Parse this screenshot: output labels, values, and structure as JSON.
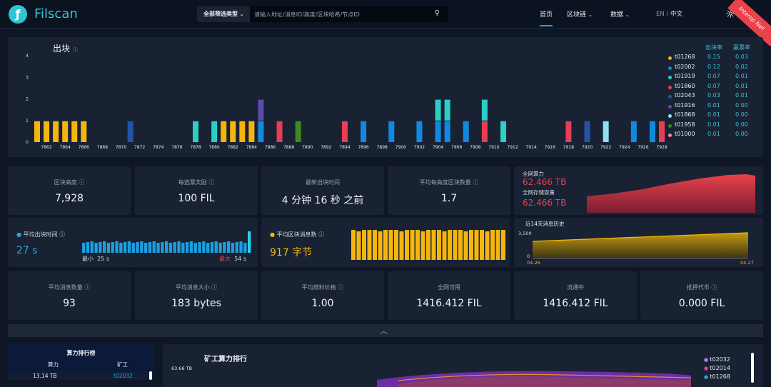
{
  "header": {
    "brand": "Filscan",
    "search_select": "全部筛选类型",
    "search_placeholder": "请输入地址/消息ID/高度/区块哈希/节点ID",
    "nav": [
      "首页",
      "区块链",
      "数据"
    ],
    "lang_en": "EN",
    "lang_sep": "/",
    "lang_zh": "中文",
    "ribbon": "Interop Net"
  },
  "blocks_chart": {
    "title": "出块",
    "col_rate1": "出块率",
    "col_rate2": "赢票率",
    "chart_data": {
      "type": "bar",
      "stacked": true,
      "ylim": [
        0,
        4
      ],
      "yticks": [
        "0",
        "1",
        "2",
        "3",
        "4"
      ],
      "x_labels": [
        "7862",
        "7864",
        "7866",
        "7868",
        "7870",
        "7872",
        "7874",
        "7876",
        "7878",
        "7880",
        "7882",
        "7884",
        "7886",
        "7888",
        "7890",
        "7892",
        "7894",
        "7896",
        "7898",
        "7900",
        "7902",
        "7904",
        "7906",
        "7908",
        "7910",
        "7912",
        "7914",
        "7916",
        "7918",
        "7920",
        "7922",
        "7924",
        "7926",
        "7928"
      ],
      "heights": [
        "7861",
        "7862",
        "7863",
        "7864",
        "7865",
        "7866",
        "7867",
        "7868",
        "7869",
        "7870",
        "7871",
        "7872",
        "7873",
        "7874",
        "7875",
        "7876",
        "7877",
        "7878",
        "7879",
        "7880",
        "7881",
        "7882",
        "7883",
        "7884",
        "7885",
        "7886",
        "7887",
        "7888",
        "7889",
        "7890",
        "7891",
        "7892",
        "7893",
        "7894",
        "7895",
        "7896",
        "7897",
        "7898",
        "7899",
        "7900",
        "7901",
        "7902",
        "7903",
        "7904",
        "7905",
        "7906",
        "7907",
        "7908",
        "7909",
        "7910",
        "7911",
        "7912",
        "7913",
        "7914",
        "7915",
        "7916",
        "7917",
        "7918",
        "7919",
        "7920",
        "7921",
        "7922",
        "7923",
        "7924",
        "7925",
        "7926",
        "7927",
        "7928"
      ],
      "stacks": [
        [
          0
        ],
        [
          0
        ],
        [
          0
        ],
        [
          0
        ],
        [
          0
        ],
        [
          0
        ],
        [],
        [],
        [],
        [],
        [
          4
        ],
        [],
        [],
        [],
        [],
        [],
        [],
        [
          2
        ],
        [],
        [
          2
        ],
        [
          0
        ],
        [
          0
        ],
        [
          0
        ],
        [
          0
        ],
        [
          1,
          5
        ],
        [],
        [
          3
        ],
        [],
        [
          7
        ],
        [],
        [],
        [],
        [],
        [
          3
        ],
        [],
        [
          1
        ],
        [],
        [],
        [
          1
        ],
        [],
        [],
        [
          1
        ],
        [],
        [
          1,
          2
        ],
        [
          1,
          2
        ],
        [],
        [
          1
        ],
        [],
        [
          3,
          2
        ],
        [],
        [
          2
        ],
        [],
        [],
        [],
        [],
        [],
        [],
        [
          3
        ],
        [],
        [
          4
        ],
        [],
        [
          6
        ],
        [],
        [],
        [
          1
        ],
        [],
        [
          1
        ],
        [
          3
        ]
      ]
    },
    "miners": [
      {
        "id": "t01268",
        "color": "#f5b50e",
        "rate1": "0.15",
        "rate2": "0.03"
      },
      {
        "id": "t02002",
        "color": "#1289e0",
        "rate1": "0.12",
        "rate2": "0.02"
      },
      {
        "id": "t01919",
        "color": "#2bcfc6",
        "rate1": "0.07",
        "rate2": "0.01"
      },
      {
        "id": "t01860",
        "color": "#e83d55",
        "rate1": "0.07",
        "rate2": "0.01"
      },
      {
        "id": "t02043",
        "color": "#2553a8",
        "rate1": "0.03",
        "rate2": "0.01"
      },
      {
        "id": "t01916",
        "color": "#5e4aa8",
        "rate1": "0.01",
        "rate2": "0.00"
      },
      {
        "id": "t01868",
        "color": "#8fe1ef",
        "rate1": "0.01",
        "rate2": "0.00"
      },
      {
        "id": "t01958",
        "color": "#3c8a20",
        "rate1": "0.01",
        "rate2": "0.00"
      },
      {
        "id": "t01000",
        "color": "#f08ca0",
        "rate1": "0.01",
        "rate2": "0.00"
      }
    ]
  },
  "stats_row1": [
    {
      "label": "区块高度",
      "value": "7,928"
    },
    {
      "label": "每选票奖励",
      "value": "100 FIL"
    },
    {
      "label": "最新出块时间",
      "value": "4 分钟 16 秒 之前"
    },
    {
      "label": "平均每高度区块数量",
      "value": "1.7"
    }
  ],
  "power": {
    "label1": "全网算力",
    "value1": "62.466 TB",
    "label2": "全网存储容量",
    "value2": "62.466 TB"
  },
  "avg_block_time": {
    "label": "平均出块时间",
    "value": "27 s",
    "min_label": "最小",
    "min_value": "25 s",
    "max_label": "最大",
    "max_value": "54 s"
  },
  "avg_block_size": {
    "label": "平均区块消息数",
    "value": "917 字节"
  },
  "msg_history": {
    "title": "近14天消息历史",
    "y_top": "3,500",
    "y_bottom": "0",
    "x_start": "04-26",
    "x_end": "04-27"
  },
  "stats_row3": [
    {
      "label": "平均消息数量",
      "value": "93"
    },
    {
      "label": "平均消息大小",
      "value": "183 bytes"
    },
    {
      "label": "平均燃料价格",
      "value": "1.00"
    },
    {
      "label": "全网可用",
      "value": "1416.412 FIL"
    },
    {
      "label": "流通中",
      "value": "1416.412 FIL"
    },
    {
      "label": "抵押代币",
      "value": "0.000 FIL"
    }
  ],
  "power_rank": {
    "title": "算力排行榜",
    "col1": "算力",
    "col2": "矿工",
    "row_power": "13.14 TB",
    "row_miner": "t02032"
  },
  "miner_rank": {
    "title": "矿工算力排行",
    "y_top": "63.66 TB",
    "legend": [
      {
        "id": "t02032",
        "color": "#b57ff0"
      },
      {
        "id": "t02014",
        "color": "#e83d8a"
      },
      {
        "id": "t01268",
        "color": "#2aa5d8"
      }
    ]
  }
}
